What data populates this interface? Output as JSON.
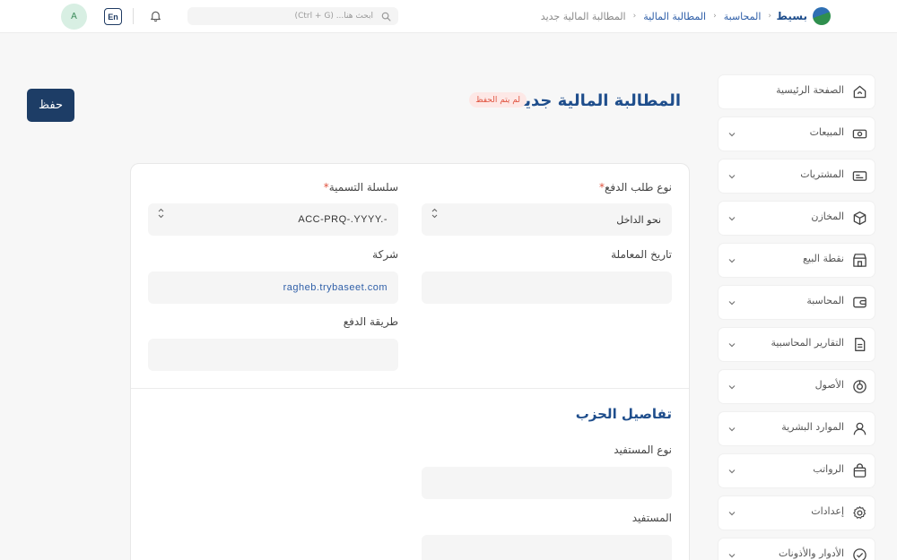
{
  "topbar": {
    "brand": "بسيط",
    "breadcrumb": [
      "المحاسبة",
      "المطالبة المالية",
      "المطالبة المالية جديد"
    ],
    "search_placeholder": "ابحث هنا... (Ctrl + G)",
    "lang_label": "En",
    "avatar_initial": "A"
  },
  "sidebar": {
    "items": [
      {
        "label": "الصفحة الرئيسية",
        "icon": "home-icon",
        "chevron": false
      },
      {
        "label": "المبيعات",
        "icon": "money-icon",
        "chevron": true
      },
      {
        "label": "المشتريات",
        "icon": "card-icon",
        "chevron": true
      },
      {
        "label": "المخازن",
        "icon": "box-icon",
        "chevron": true
      },
      {
        "label": "نقطة البيع",
        "icon": "store-icon",
        "chevron": true
      },
      {
        "label": "المحاسبة",
        "icon": "wallet-icon",
        "chevron": true
      },
      {
        "label": "التقارير المحاسبية",
        "icon": "report-icon",
        "chevron": true
      },
      {
        "label": "الأصول",
        "icon": "pie-icon",
        "chevron": true
      },
      {
        "label": "الموارد البشرية",
        "icon": "user-icon",
        "chevron": true
      },
      {
        "label": "الرواتب",
        "icon": "bag-icon",
        "chevron": true
      },
      {
        "label": "إعدادات",
        "icon": "gear-icon",
        "chevron": true
      },
      {
        "label": "الأدوار والأذونات",
        "icon": "shield-check-icon",
        "chevron": true
      }
    ]
  },
  "header": {
    "title": "المطالبة المالية جديد",
    "status": "لم يتم الحفظ",
    "save_label": "حفظ"
  },
  "form": {
    "payment_type": {
      "label": "نوع طلب الدفع",
      "value": "نحو الداخل"
    },
    "naming_series": {
      "label": "سلسلة التسمية",
      "value": "ACC-PRQ-.YYYY.-"
    },
    "transaction_date": {
      "label": "تاريخ المعاملة",
      "value": ""
    },
    "company": {
      "label": "شركة",
      "value": "ragheb.trybaseet.com"
    },
    "payment_method": {
      "label": "طريقة الدفع",
      "value": ""
    },
    "party_section_title": "تفاصيل الحزب",
    "party_type": {
      "label": "نوع المستفيد",
      "value": ""
    },
    "party": {
      "label": "المستفيد",
      "value": ""
    }
  },
  "colors": {
    "primary": "#1d3d66",
    "accent_blue": "#1f4e8c",
    "status_red": "#e0533f",
    "status_bg": "#fde8e6"
  }
}
